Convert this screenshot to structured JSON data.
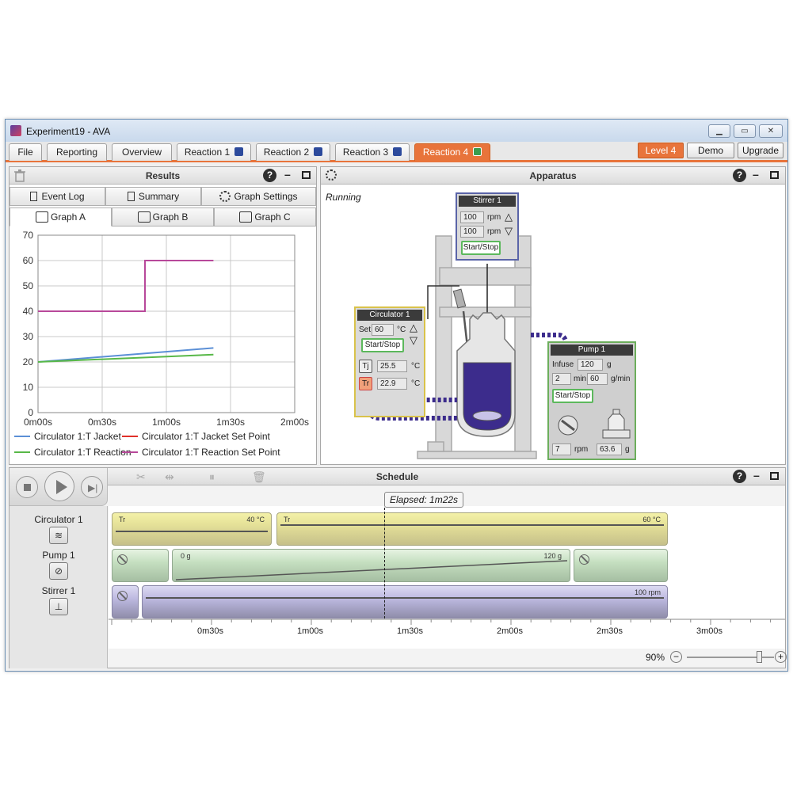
{
  "window": {
    "title": "Experiment19 - AVA"
  },
  "menu": {
    "tabs": [
      "File",
      "Reporting",
      "Overview",
      "Reaction 1",
      "Reaction 2",
      "Reaction 3",
      "Reaction 4"
    ],
    "right_buttons": [
      "Level 4",
      "Demo",
      "Upgrade"
    ]
  },
  "results": {
    "title": "Results",
    "top_tabs": [
      "Event Log",
      "Summary",
      "Graph Settings"
    ],
    "graph_tabs": [
      "Graph A",
      "Graph B",
      "Graph C"
    ]
  },
  "chart_data": {
    "type": "line",
    "x_ticks": [
      "0m00s",
      "0m30s",
      "1m00s",
      "1m30s",
      "2m00s"
    ],
    "xlim_s": [
      0,
      120
    ],
    "ylim": [
      0,
      70
    ],
    "y_ticks": [
      0,
      10,
      20,
      30,
      40,
      50,
      60,
      70
    ],
    "grid": true,
    "legend_placement": "bottom",
    "series": [
      {
        "name": "Circulator 1:T Jacket",
        "color": "#5b8fd6",
        "points": [
          [
            0,
            20
          ],
          [
            82,
            25.5
          ]
        ]
      },
      {
        "name": "Circulator 1:T Jacket Set Point",
        "color": "#e0302a",
        "points": []
      },
      {
        "name": "Circulator 1:T Reaction",
        "color": "#58b848",
        "points": [
          [
            0,
            20
          ],
          [
            82,
            22.9
          ]
        ]
      },
      {
        "name": "Circulator 1:T Reaction Set Point",
        "color": "#b8489a",
        "points": [
          [
            0,
            40
          ],
          [
            50,
            40
          ],
          [
            50,
            60
          ],
          [
            82,
            60
          ]
        ]
      }
    ]
  },
  "apparatus": {
    "title": "Apparatus",
    "status": "Running",
    "stirrer": {
      "title": "Stirrer 1",
      "set1": "100",
      "set2": "100",
      "unit": "rpm",
      "button": "Start/Stop"
    },
    "circulator": {
      "title": "Circulator 1",
      "set_label": "Set",
      "set_value": "60",
      "unit": "°C",
      "button": "Start/Stop",
      "tj_label": "Tj",
      "tj_value": "25.5",
      "tr_label": "Tr",
      "tr_value": "22.9"
    },
    "pump": {
      "title": "Pump 1",
      "infuse_label": "Infuse",
      "infuse_value": "120",
      "infuse_unit": "g",
      "time_value": "2",
      "time_unit": "min",
      "rate_value": "60",
      "rate_unit": "g/min",
      "button": "Start/Stop",
      "rpm_value": "7",
      "rpm_unit": "rpm",
      "mass_value": "63.6",
      "mass_unit": "g"
    }
  },
  "schedule": {
    "title": "Schedule",
    "elapsed": "Elapsed: 1m22s",
    "rows": [
      {
        "label": "Circulator 1",
        "icon": "coil-icon"
      },
      {
        "label": "Pump 1",
        "icon": "pump-icon"
      },
      {
        "label": "Stirrer 1",
        "icon": "stirrer-icon"
      }
    ],
    "circ_bar1": {
      "left": "Tr",
      "right": "40 °C"
    },
    "circ_bar2": {
      "left": "Tr",
      "right": "60 °C"
    },
    "pump_bar": {
      "left": "0 g",
      "right": "120 g"
    },
    "stir_bar": {
      "right": "100 rpm"
    },
    "ticks": [
      "0m30s",
      "1m00s",
      "1m30s",
      "2m00s",
      "2m30s",
      "3m00s"
    ],
    "zoom": "90%"
  },
  "colors": {
    "accent": "#e8743b",
    "reaction_square": "#2c4a9c",
    "running_green": "#3a9d4f"
  }
}
